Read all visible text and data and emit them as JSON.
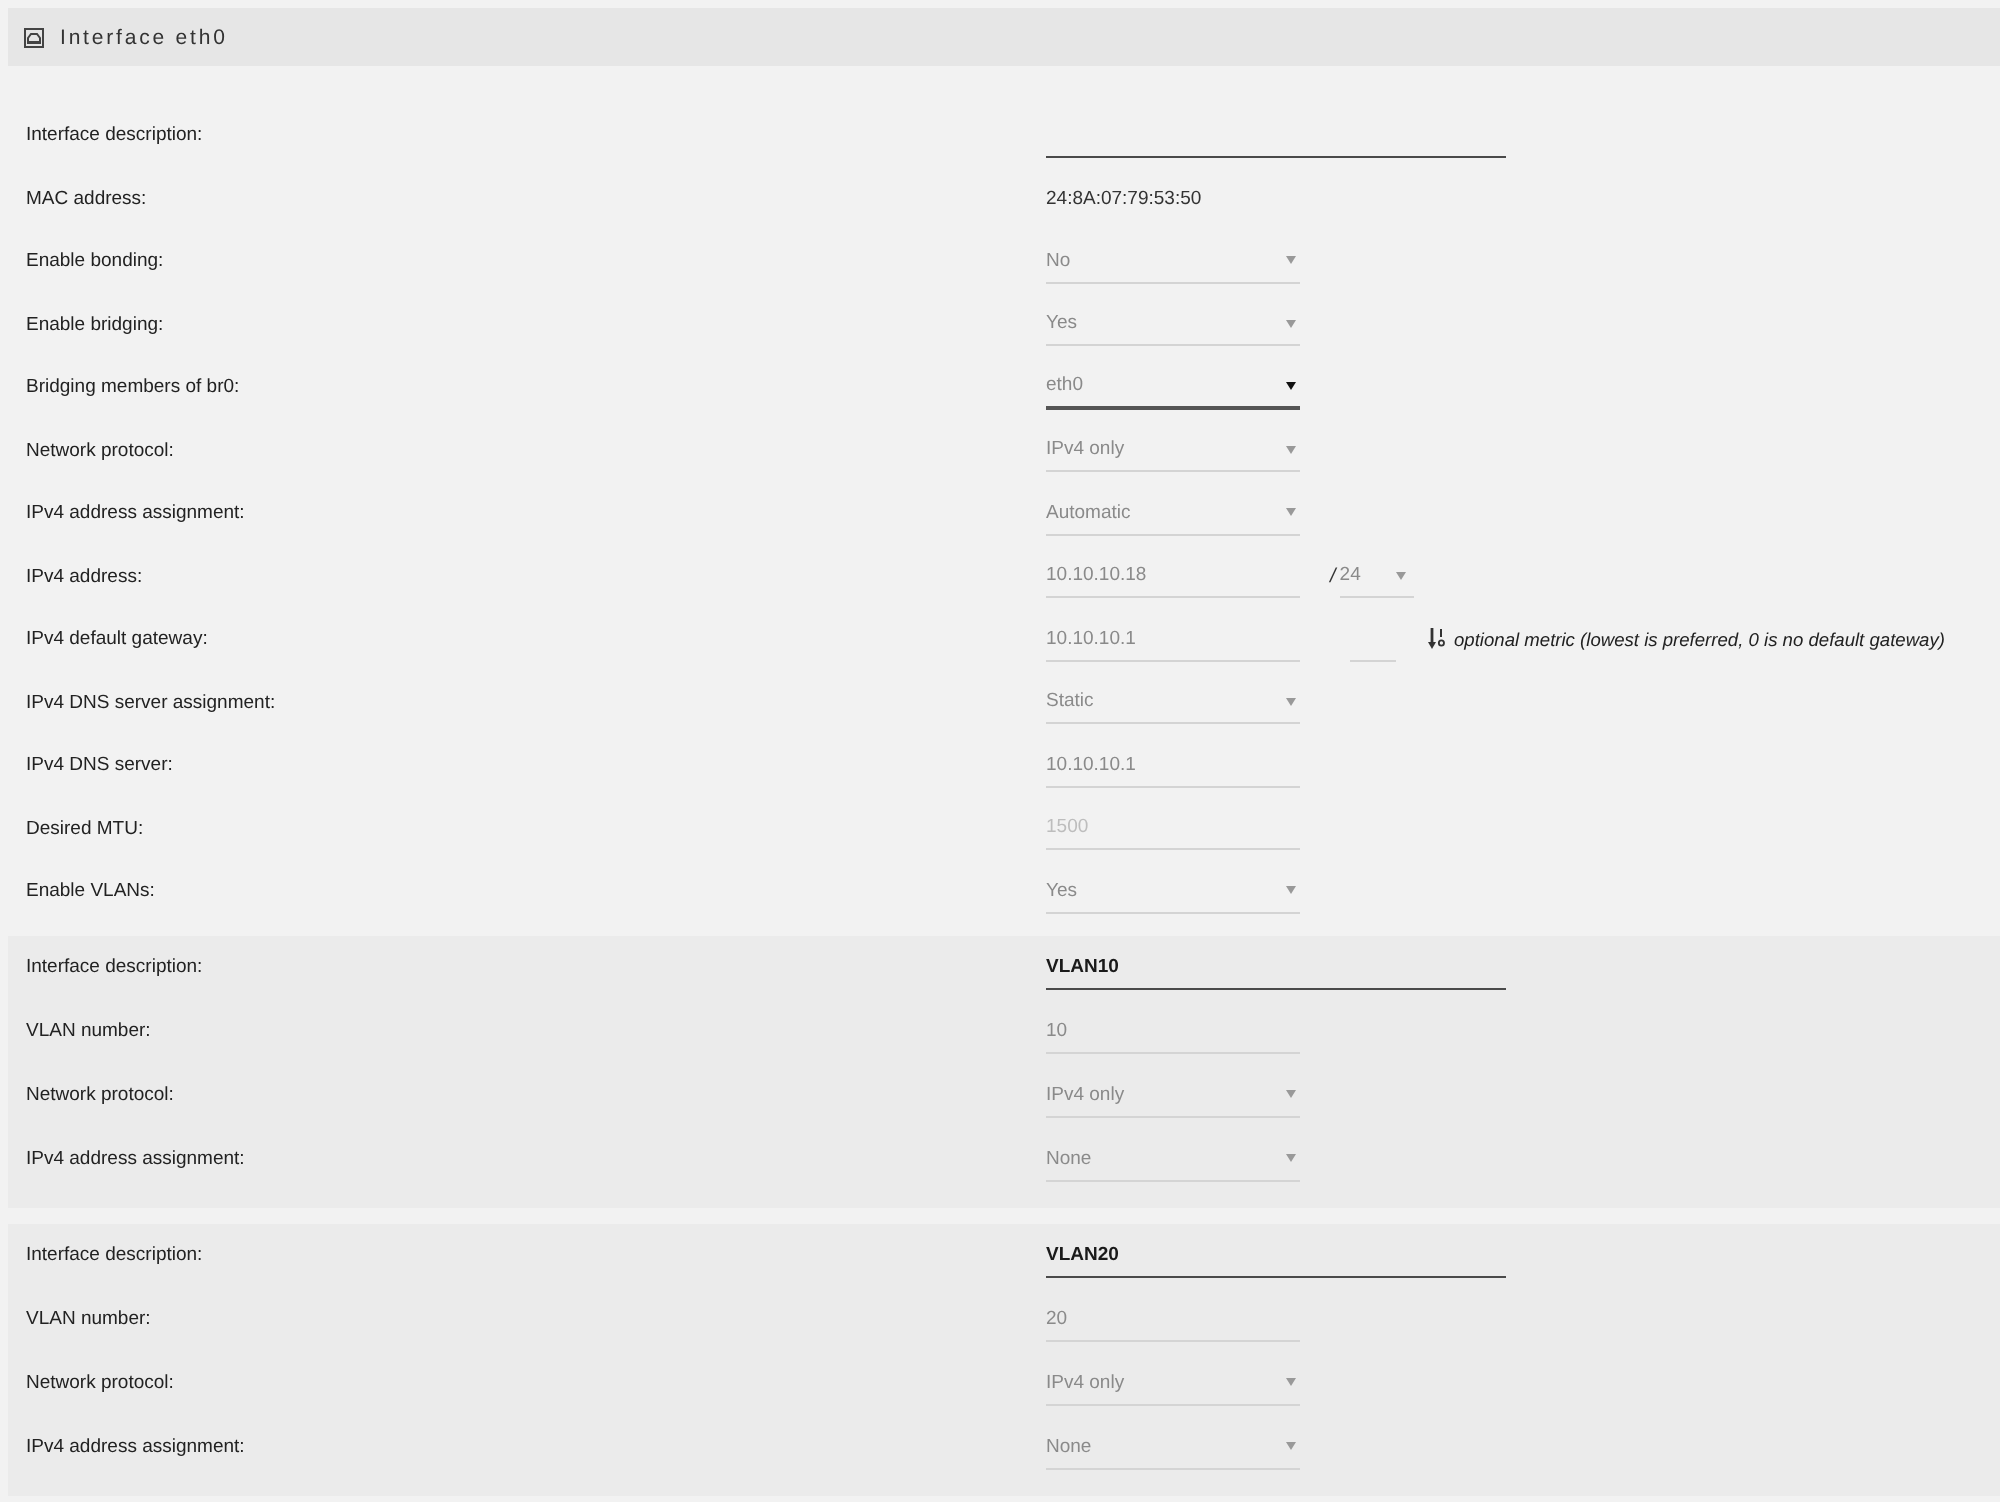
{
  "header": {
    "title": "Interface eth0"
  },
  "rows": [
    {
      "label": "Interface description:",
      "kind": "text"
    },
    {
      "label": "MAC address:",
      "kind": "static",
      "value": "24:8A:07:79:53:50"
    },
    {
      "label": "Enable bonding:",
      "kind": "select",
      "value": "No"
    },
    {
      "label": "Enable bridging:",
      "kind": "select",
      "value": "Yes"
    },
    {
      "label": "Bridging members of br0:",
      "kind": "multiselect",
      "value": "eth0"
    },
    {
      "label": "Network protocol:",
      "kind": "select",
      "value": "IPv4 only"
    },
    {
      "label": "IPv4 address assignment:",
      "kind": "select",
      "value": "Automatic"
    },
    {
      "label": "IPv4 address:",
      "kind": "input",
      "value": "10.10.10.18",
      "prefix": {
        "separator": "/",
        "value": "24"
      }
    },
    {
      "label": "IPv4 default gateway:",
      "kind": "input",
      "value": "10.10.10.1",
      "metric": {
        "hint": "optional metric (lowest is preferred, 0 is no default gateway)"
      }
    },
    {
      "label": "IPv4 DNS server assignment:",
      "kind": "select",
      "value": "Static"
    },
    {
      "label": "IPv4 DNS server:",
      "kind": "input",
      "value": "10.10.10.1"
    },
    {
      "label": "Desired MTU:",
      "kind": "input",
      "placeholder": "1500"
    },
    {
      "label": "Enable VLANs:",
      "kind": "select",
      "value": "Yes"
    }
  ],
  "vlans": [
    {
      "rows": [
        {
          "label": "Interface description:",
          "kind": "text",
          "value": "VLAN10"
        },
        {
          "label": "VLAN number:",
          "kind": "input",
          "value": "10"
        },
        {
          "label": "Network protocol:",
          "kind": "select",
          "value": "IPv4 only"
        },
        {
          "label": "IPv4 address assignment:",
          "kind": "select",
          "value": "None"
        }
      ]
    },
    {
      "rows": [
        {
          "label": "Interface description:",
          "kind": "text",
          "value": "VLAN20"
        },
        {
          "label": "VLAN number:",
          "kind": "input",
          "value": "20"
        },
        {
          "label": "Network protocol:",
          "kind": "select",
          "value": "IPv4 only"
        },
        {
          "label": "IPv4 address assignment:",
          "kind": "select",
          "value": "None"
        }
      ]
    }
  ]
}
